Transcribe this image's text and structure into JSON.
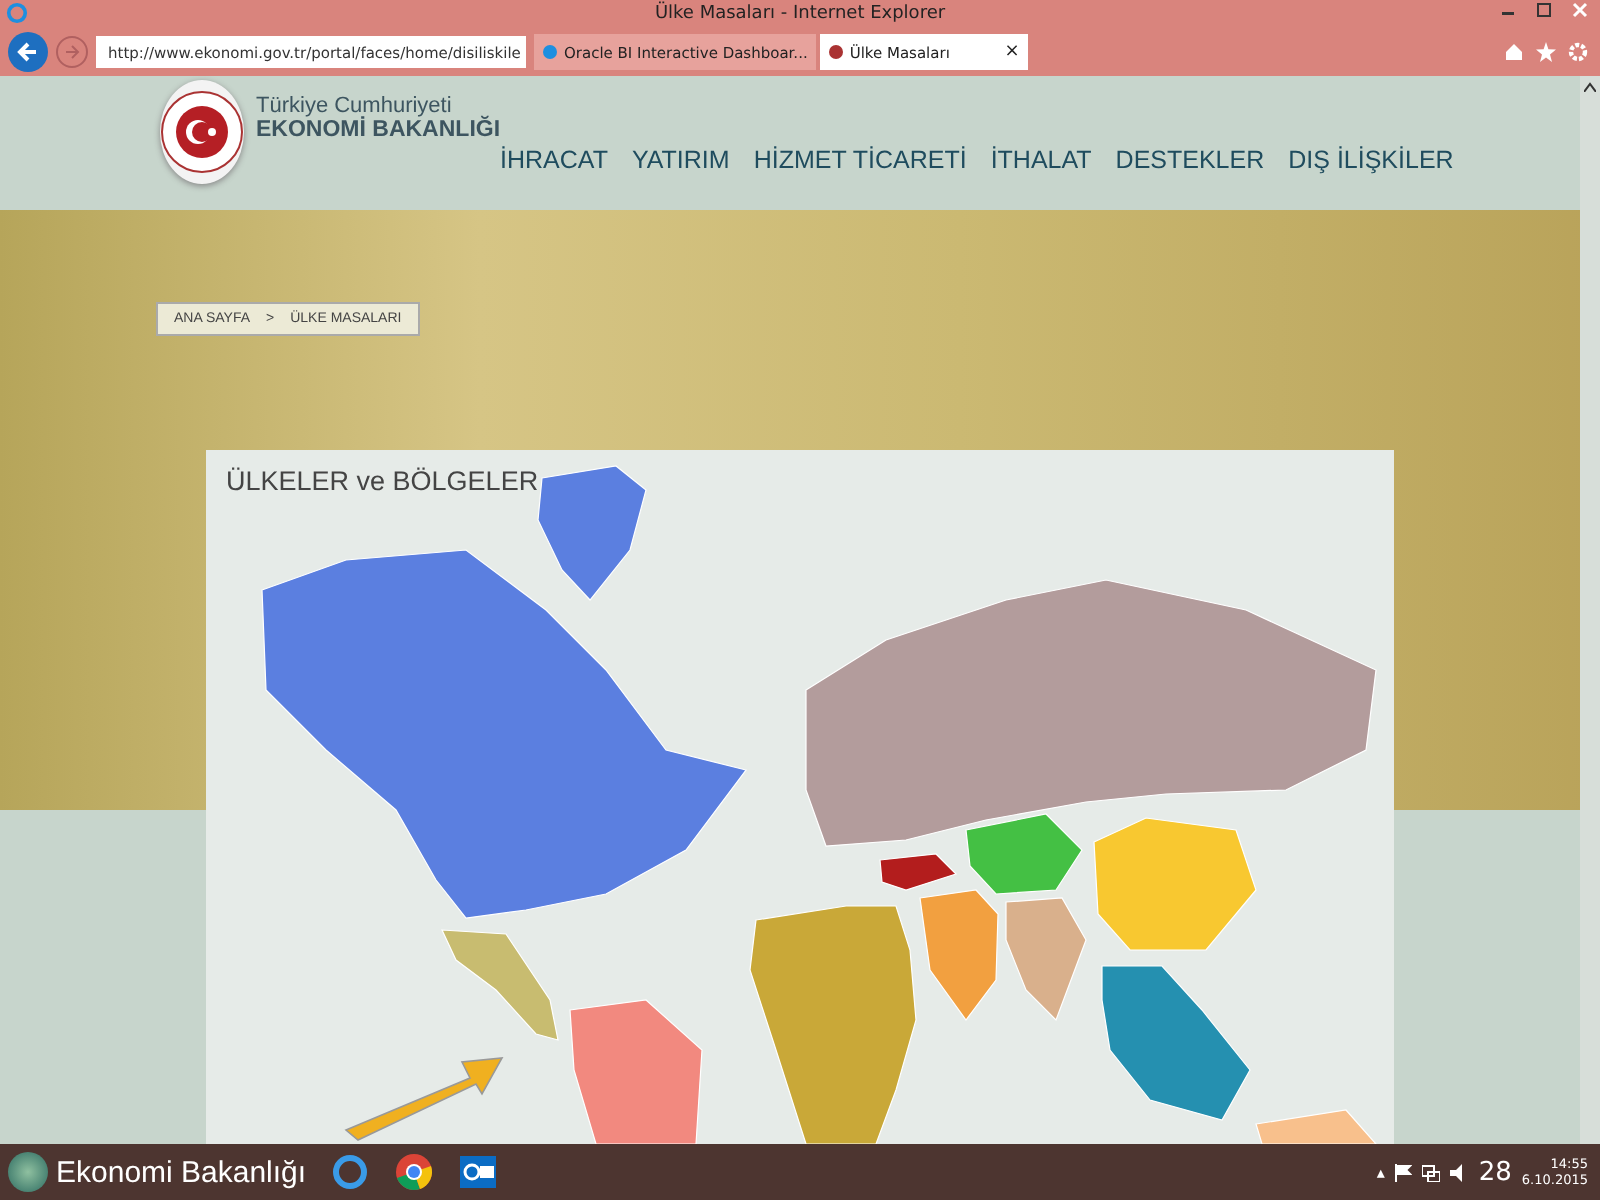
{
  "window": {
    "title": "Ülke Masaları - Internet Explorer"
  },
  "browser": {
    "url": "http://www.ekonomi.gov.tr/portal/faces/home/disiliskile",
    "tabs": [
      {
        "label": "Oracle BI Interactive Dashboar...",
        "selected": false
      },
      {
        "label": "Ülke Masaları",
        "selected": true,
        "close": "×"
      }
    ]
  },
  "site": {
    "name_top": "Türkiye Cumhuriyeti",
    "name_bottom": "EKONOMİ BAKANLIĞI",
    "nav": [
      "İHRACAT",
      "YATIRIM",
      "HİZMET TİCARETİ",
      "İTHALAT",
      "DESTEKLER",
      "DIŞ İLİŞKİLER"
    ],
    "breadcrumb": [
      "ANA SAYFA",
      ">",
      "ÜLKE MASALARI"
    ]
  },
  "panel": {
    "title": "ÜLKELER ve BÖLGELER",
    "regions": [
      {
        "kind": "greenland",
        "color": "#5b7fe0"
      },
      {
        "kind": "north-america",
        "color": "#5b7fe0"
      },
      {
        "kind": "central-america",
        "color": "#c8bc70"
      },
      {
        "kind": "south-america",
        "color": "#f2897f"
      },
      {
        "kind": "europe-russia",
        "color": "#b39c9c"
      },
      {
        "kind": "africa",
        "color": "#c9a838"
      },
      {
        "kind": "middle-east",
        "color": "#f2a040"
      },
      {
        "kind": "turkey",
        "color": "#b31d1d"
      },
      {
        "kind": "central-asia",
        "color": "#44c044"
      },
      {
        "kind": "south-asia",
        "color": "#d9b08c"
      },
      {
        "kind": "east-asia",
        "color": "#f8c830"
      },
      {
        "kind": "southeast-asia",
        "color": "#2590b0"
      },
      {
        "kind": "australia",
        "color": "#f8c08c"
      }
    ]
  },
  "taskbar": {
    "label": "Ekonomi Bakanlığı",
    "tray_toggle": "▴",
    "clock_extra": "28",
    "time": "14:55",
    "date": "6.10.2015"
  }
}
